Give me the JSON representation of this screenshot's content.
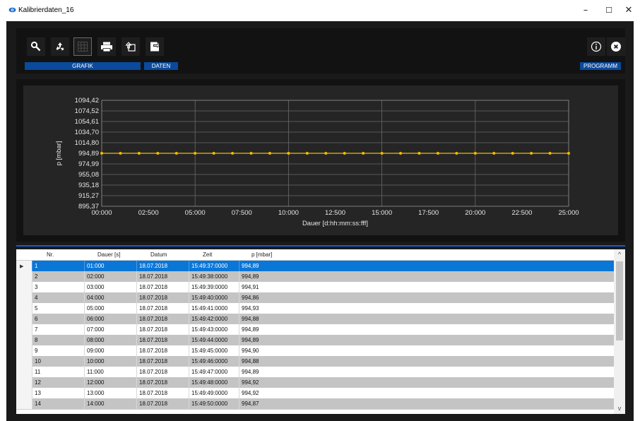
{
  "window": {
    "title": "Kalibrierdaten_16",
    "minimize": "–",
    "maximize": "☐",
    "close": "✕"
  },
  "toolbar": {
    "buttons": [
      {
        "name": "search-icon",
        "active": false
      },
      {
        "name": "recycle-icon",
        "active": false
      },
      {
        "name": "grid-icon",
        "active": true
      },
      {
        "name": "printer-icon",
        "active": false
      },
      {
        "name": "export-icon",
        "active": false
      },
      {
        "name": "import-icon",
        "active": false
      },
      {
        "name": "info-icon",
        "active": false
      },
      {
        "name": "close-circle-icon",
        "active": false
      }
    ],
    "groups": {
      "grafik": "GRAFIK",
      "daten": "DATEN",
      "programm": "PROGRAMM"
    },
    "info_glyph": "i",
    "close_glyph": "x"
  },
  "chart_data": {
    "type": "line",
    "title": "",
    "xlabel": "Dauer [d:hh:mm:ss:fff]",
    "ylabel": "p [mbar]",
    "x_ticks": [
      "00:000",
      "02:500",
      "05:000",
      "07:500",
      "10:000",
      "12:500",
      "15:000",
      "17:500",
      "20:000",
      "22:500",
      "25:000"
    ],
    "y_ticks": [
      "1094,42",
      "1074,52",
      "1054,61",
      "1034,70",
      "1014,80",
      "994,89",
      "974,99",
      "955,08",
      "935,18",
      "915,27",
      "895,37"
    ],
    "xlim": [
      0,
      25
    ],
    "ylim": [
      895.37,
      1094.42
    ],
    "series": [
      {
        "color": "#f5b800",
        "x": [
          0,
          1,
          2,
          3,
          4,
          5,
          6,
          7,
          8,
          9,
          10,
          11,
          12,
          13,
          14,
          15,
          16,
          17,
          18,
          19,
          20,
          21,
          22,
          23,
          24,
          25
        ],
        "y": [
          994.89,
          994.89,
          994.89,
          994.91,
          994.86,
          994.93,
          994.88,
          994.89,
          994.89,
          994.9,
          994.88,
          994.89,
          994.92,
          994.92,
          994.87,
          994.89,
          994.89,
          994.89,
          994.89,
          994.89,
          994.89,
          994.89,
          994.89,
          994.89,
          994.89,
          994.89
        ]
      }
    ],
    "grid": true
  },
  "table": {
    "columns": [
      "Nr.",
      "Dauer [s]",
      "Datum",
      "Zeit",
      "p [mbar]"
    ],
    "rows": [
      [
        "1",
        "01:000",
        "18.07.2018",
        "15:49:37:0000",
        "994,89"
      ],
      [
        "2",
        "02:000",
        "18.07.2018",
        "15:49:38:0000",
        "994,89"
      ],
      [
        "3",
        "03:000",
        "18.07.2018",
        "15:49:39:0000",
        "994,91"
      ],
      [
        "4",
        "04:000",
        "18.07.2018",
        "15:49:40:0000",
        "994,86"
      ],
      [
        "5",
        "05:000",
        "18.07.2018",
        "15:49:41:0000",
        "994,93"
      ],
      [
        "6",
        "06:000",
        "18.07.2018",
        "15:49:42:0000",
        "994,88"
      ],
      [
        "7",
        "07:000",
        "18.07.2018",
        "15:49:43:0000",
        "994,89"
      ],
      [
        "8",
        "08:000",
        "18.07.2018",
        "15:49:44:0000",
        "994,89"
      ],
      [
        "9",
        "09:000",
        "18.07.2018",
        "15:49:45:0000",
        "994,90"
      ],
      [
        "10",
        "10:000",
        "18.07.2018",
        "15:49:46:0000",
        "994,88"
      ],
      [
        "11",
        "11:000",
        "18.07.2018",
        "15:49:47:0000",
        "994,89"
      ],
      [
        "12",
        "12:000",
        "18.07.2018",
        "15:49:48:0000",
        "994,92"
      ],
      [
        "13",
        "13:000",
        "18.07.2018",
        "15:49:49:0000",
        "994,92"
      ],
      [
        "14",
        "14:000",
        "18.07.2018",
        "15:49:50:0000",
        "994,87"
      ]
    ],
    "selected_row": 0,
    "row_selector_glyph": "▶",
    "scroll_up": "^",
    "scroll_down": "v"
  },
  "colors": {
    "accent": "#0a76d6",
    "label_bar": "#0a4a9c",
    "series": "#f5b800"
  }
}
